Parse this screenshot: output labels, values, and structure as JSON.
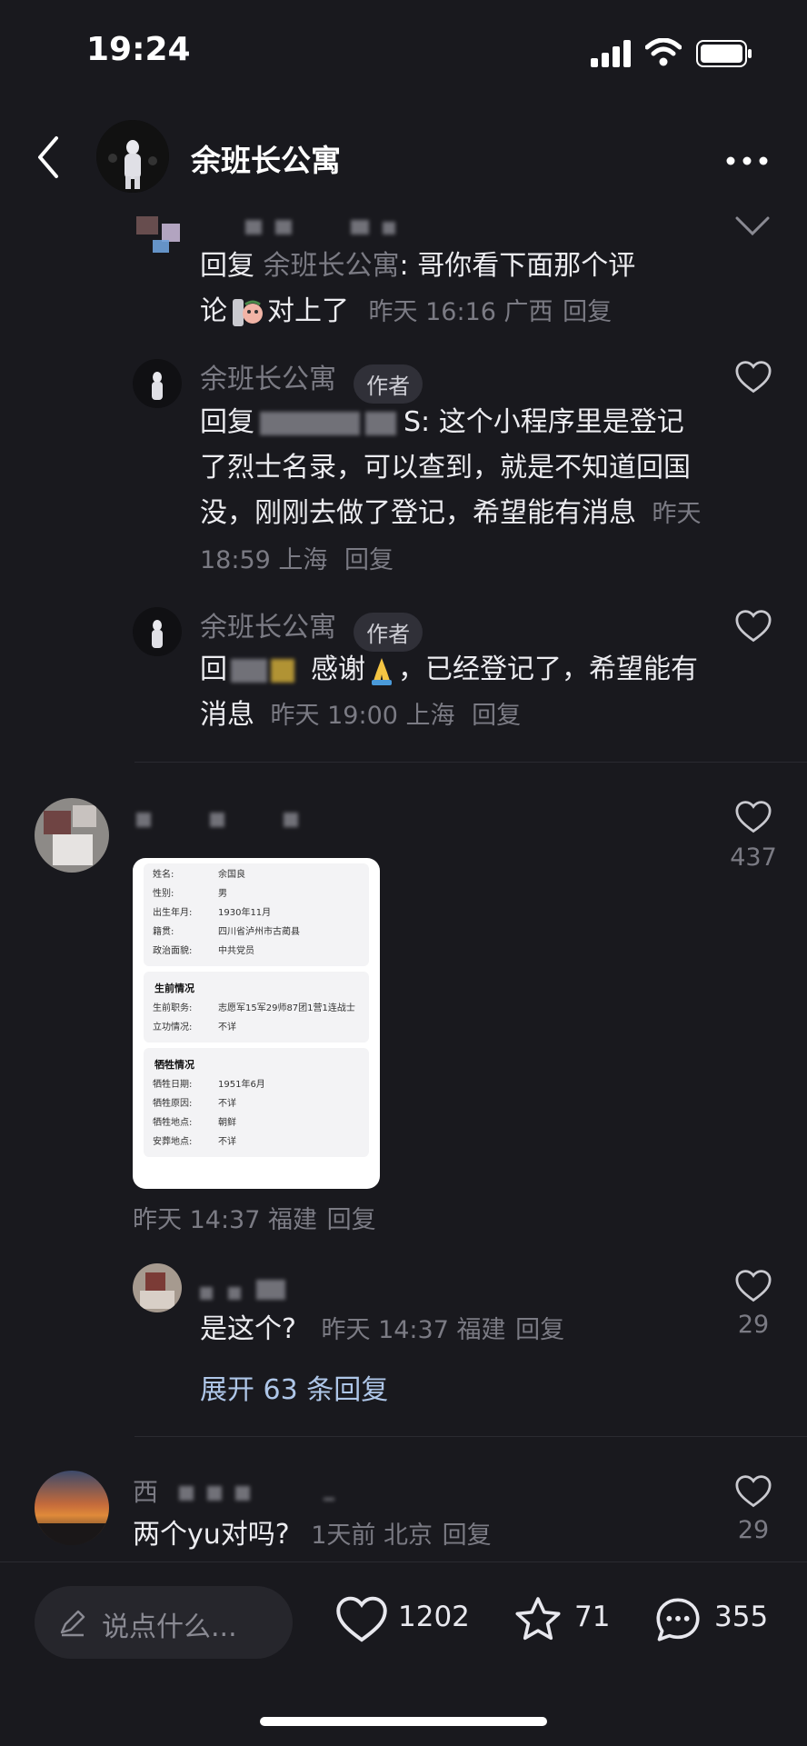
{
  "status_bar": {
    "time": "19:24"
  },
  "header": {
    "title": "余班长公寓"
  },
  "replies_top": [
    {
      "prefix": "回复",
      "reply_to": "余班长公寓",
      "text_a": ": 哥你看下面那个评",
      "text_b": "论",
      "text_c": "对上了",
      "time": "昨天 16:16",
      "location": "广西",
      "reply": "回复"
    },
    {
      "author": "余班长公寓",
      "badge": "作者",
      "prefix": "回复",
      "suffix": "S",
      "text": ": 这个小程序里是登记了烈士名录，可以查到，就是不知道回国没，刚刚去做了登记，希望能有消息",
      "time": "昨天 18:59",
      "location": "上海",
      "reply": "回复"
    },
    {
      "author": "余班长公寓",
      "badge": "作者",
      "prefix": "回",
      "text_a": "感谢",
      "text_b": "，已经登记了，希望能有消息",
      "time": "昨天 19:00",
      "location": "上海",
      "reply": "回复"
    }
  ],
  "comment_main": {
    "like_count": "437",
    "time": "昨天 14:37",
    "location": "福建",
    "reply": "回复",
    "card": {
      "section1": [
        {
          "k": "姓名:",
          "v": "余国良"
        },
        {
          "k": "性别:",
          "v": "男"
        },
        {
          "k": "出生年月:",
          "v": "1930年11月"
        },
        {
          "k": "籍贯:",
          "v": "四川省泸州市古蔺县"
        },
        {
          "k": "政治面貌:",
          "v": "中共党员"
        }
      ],
      "section2_title": "生前情况",
      "section2": [
        {
          "k": "生前职务:",
          "v": "志愿军15军29师87团1营1连战士"
        },
        {
          "k": "立功情况:",
          "v": "不详"
        }
      ],
      "section3_title": "牺牲情况",
      "section3": [
        {
          "k": "牺牲日期:",
          "v": "1951年6月"
        },
        {
          "k": "牺牲原因:",
          "v": "不详"
        },
        {
          "k": "牺牲地点:",
          "v": "朝鲜"
        },
        {
          "k": "安葬地点:",
          "v": "不详"
        }
      ]
    },
    "sub_reply": {
      "text": "是这个?",
      "time": "昨天 14:37",
      "location": "福建",
      "reply": "回复",
      "like_count": "29"
    },
    "expand": "展开 63 条回复"
  },
  "comment_last": {
    "name_char": "西",
    "text": "两个yu对吗?",
    "time": "1天前",
    "location": "北京",
    "reply": "回复",
    "like_count": "29"
  },
  "bottom_bar": {
    "input_placeholder": "说点什么...",
    "likes": "1202",
    "stars": "71",
    "comments": "355"
  },
  "colors": {
    "background": "#19191e",
    "muted": "#7b7b84",
    "text": "#ececf0"
  }
}
